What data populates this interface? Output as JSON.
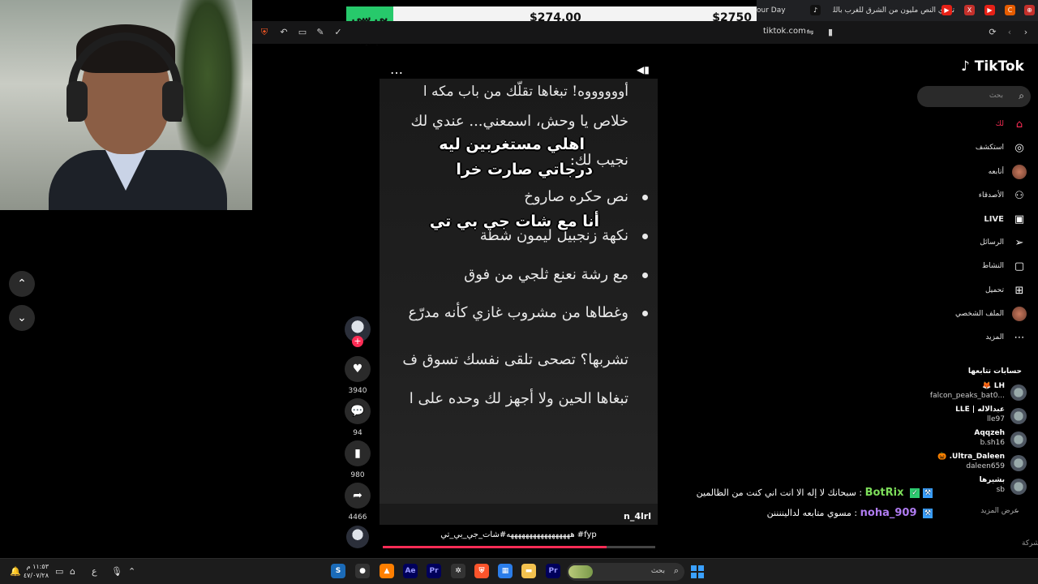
{
  "overlay": {
    "tag": "بي سي جديد",
    "price_mid": "$274.00",
    "price_right": "$2750"
  },
  "browser": {
    "tabs": [
      {
        "label": "our Day",
        "icon": "generic-tab-icon"
      },
      {
        "label": "",
        "icon": "tiktok-tab-icon"
      },
      {
        "label": "تحدي النص مليون من الشرق للغرب بالك",
        "icon": "youtube-tab-icon"
      }
    ],
    "url": "tiktok.com"
  },
  "video": {
    "lines": [
      "أووووووه! تبغاها تقلّك من باب مكه ا",
      "خلاص يا وحش، اسمعني... عندي لك",
      "نجيب لك:",
      "نص حكره صاروخ",
      "نكهة زنجبيل ليمون شطة",
      "مع رشة نعنع ثلجي من فوق",
      "وغطاها من مشروب غازي كأنه مدرّع",
      "تشربها؟ تصحى تلقى نفسك تسوق ف",
      "تبغاها الحين ولا أجهز لك وحده على ا"
    ],
    "captions": [
      "اهلي مستغربين ليه",
      "درجاتي صارت خرا",
      "أنا مع شات جي بي تي"
    ],
    "author": "n_4lrl",
    "description": "هههههههههههههههههه#شات_جي_بي_تي #fyp",
    "progress": 0.82,
    "menu_icon": "more-dots-icon",
    "volume_icon": "volume-icon"
  },
  "actions": {
    "likes": "3940",
    "comments": "94",
    "saves": "980",
    "shares": "4466"
  },
  "sidebar": {
    "logo": "TikTok",
    "search_placeholder": "بحث",
    "nav": [
      {
        "label": "لك",
        "icon": "home-icon",
        "active": true
      },
      {
        "label": "استكشف",
        "icon": "compass-icon"
      },
      {
        "label": "أتابعه",
        "icon": "avatar"
      },
      {
        "label": "الأصدقاء",
        "icon": "friends-icon"
      },
      {
        "label": "LIVE",
        "icon": "live-icon"
      },
      {
        "label": "الرسائل",
        "icon": "send-icon"
      },
      {
        "label": "النشاط",
        "icon": "activity-icon"
      },
      {
        "label": "تحميل",
        "icon": "upload-icon"
      },
      {
        "label": "الملف الشخصي",
        "icon": "profile-icon"
      },
      {
        "label": "المزيد",
        "icon": "more-icon"
      }
    ],
    "following_title": "حسابات تتابعها",
    "following": [
      {
        "name": "LH 🦊",
        "handle": "falcon_peaks_bat0..."
      },
      {
        "name": "عبدالاله | LLE",
        "handle": "lle97"
      },
      {
        "name": "Aqqzeh",
        "handle": "b.sh16"
      },
      {
        "name": "Ultra_Daleen. 🎃",
        "handle": "daleen659"
      },
      {
        "name": "بشيرها",
        "handle": "sb"
      }
    ],
    "see_more": "عرض المزيد",
    "company": "الشركة"
  },
  "chat": [
    {
      "name": "BotRix",
      "text": "سبحانك لا إله الا انت اني كنت من الظالمين",
      "color": "#7dde5a"
    },
    {
      "name": "noha_909",
      "text": "مسوي متابعه لداليننننن",
      "color": "#b07cf2"
    }
  ],
  "taskbar": {
    "clock_time": "١١:٥٣ م",
    "clock_date": "٤٧/٠٧/٢٨",
    "lang": "ع",
    "search": "بحث"
  }
}
